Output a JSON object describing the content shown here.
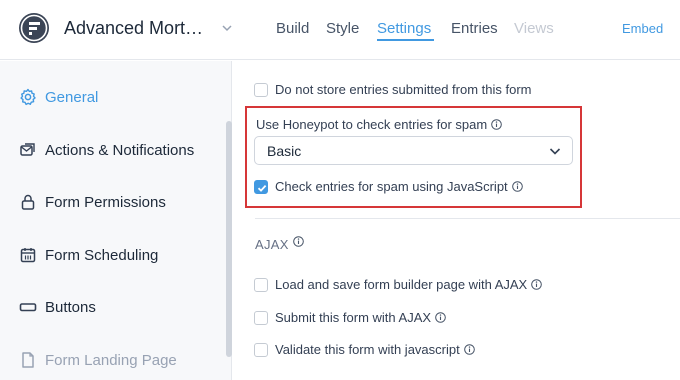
{
  "header": {
    "form_title": "Advanced Mort…",
    "tabs": [
      {
        "label": "Build"
      },
      {
        "label": "Style"
      },
      {
        "label": "Settings"
      },
      {
        "label": "Entries"
      },
      {
        "label": "Views"
      }
    ],
    "active_tab": "Settings",
    "disabled_tab": "Views",
    "embed_label": "Embed"
  },
  "sidebar": {
    "items": [
      {
        "label": "General",
        "icon": "gear-icon"
      },
      {
        "label": "Actions & Notifications",
        "icon": "notifications-icon"
      },
      {
        "label": "Form Permissions",
        "icon": "lock-icon"
      },
      {
        "label": "Form Scheduling",
        "icon": "calendar-icon"
      },
      {
        "label": "Buttons",
        "icon": "button-icon"
      },
      {
        "label": "Form Landing Page",
        "icon": "landing-page-icon"
      }
    ],
    "active_item": "General"
  },
  "settings": {
    "no_store_entries": {
      "label": "Do not store entries submitted from this form",
      "checked": false
    },
    "honeypot": {
      "label": "Use Honeypot to check entries for spam",
      "selected": "Basic"
    },
    "js_spam_check": {
      "label": "Check entries for spam using JavaScript",
      "checked": true
    },
    "ajax": {
      "title": "AJAX",
      "options": [
        {
          "label": "Load and save form builder page with AJAX",
          "checked": false
        },
        {
          "label": "Submit this form with AJAX",
          "checked": false
        },
        {
          "label": "Validate this form with javascript",
          "checked": false
        }
      ]
    }
  },
  "colors": {
    "accent": "#4199e1",
    "highlight_border": "#d63638",
    "sidebar_bg": "#f7f8fa"
  }
}
